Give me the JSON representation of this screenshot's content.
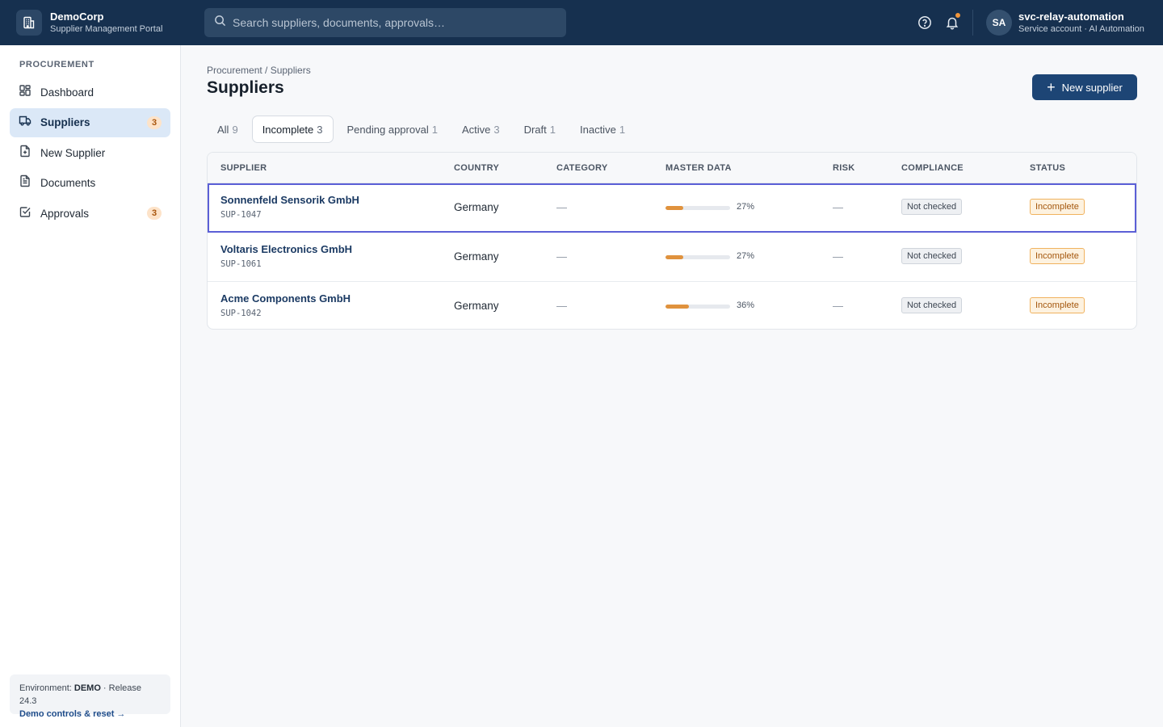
{
  "app": {
    "name": "DemoCorp",
    "subtitle": "Supplier Management Portal"
  },
  "search": {
    "placeholder": "Search suppliers, documents, approvals…",
    "value": ""
  },
  "user": {
    "initials": "SA",
    "name": "svc-relay-automation",
    "role": "Service account · AI Automation"
  },
  "sidebar": {
    "section": "PROCUREMENT",
    "items": [
      {
        "label": "Dashboard",
        "icon": "dashboard-icon",
        "badge": ""
      },
      {
        "label": "Suppliers",
        "icon": "truck-icon",
        "badge": "3",
        "active": true
      },
      {
        "label": "New Supplier",
        "icon": "file-plus-icon",
        "badge": ""
      },
      {
        "label": "Documents",
        "icon": "document-icon",
        "badge": ""
      },
      {
        "label": "Approvals",
        "icon": "check-square-icon",
        "badge": "3"
      }
    ],
    "env": {
      "prefix": "Environment: ",
      "name": "DEMO",
      "release": " · Release 24.3",
      "link": "Demo controls & reset →"
    }
  },
  "page": {
    "breadcrumb": "Procurement / Suppliers",
    "title": "Suppliers",
    "new_button": "New supplier"
  },
  "tabs": [
    {
      "label": "All",
      "count": "9"
    },
    {
      "label": "Incomplete",
      "count": "3",
      "active": true
    },
    {
      "label": "Pending approval",
      "count": "1"
    },
    {
      "label": "Active",
      "count": "3"
    },
    {
      "label": "Draft",
      "count": "1"
    },
    {
      "label": "Inactive",
      "count": "1"
    }
  ],
  "table": {
    "columns": [
      "SUPPLIER",
      "COUNTRY",
      "CATEGORY",
      "MASTER DATA",
      "RISK",
      "COMPLIANCE",
      "STATUS"
    ],
    "rows": [
      {
        "name": "Sonnenfeld Sensorik GmbH",
        "id": "SUP-1047",
        "country": "Germany",
        "category": "—",
        "master_data_pct": 27,
        "master_data_label": "27%",
        "risk": "—",
        "compliance": "Not checked",
        "status": "Incomplete",
        "selected": true
      },
      {
        "name": "Voltaris Electronics GmbH",
        "id": "SUP-1061",
        "country": "Germany",
        "category": "—",
        "master_data_pct": 27,
        "master_data_label": "27%",
        "risk": "—",
        "compliance": "Not checked",
        "status": "Incomplete"
      },
      {
        "name": "Acme Components GmbH",
        "id": "SUP-1042",
        "country": "Germany",
        "category": "—",
        "master_data_pct": 36,
        "master_data_label": "36%",
        "risk": "—",
        "compliance": "Not checked",
        "status": "Incomplete"
      }
    ]
  },
  "colors": {
    "topbar": "#16304f",
    "accent": "#1d4575",
    "progress": "#e0923d",
    "selected_outline": "#5b5fd6"
  }
}
